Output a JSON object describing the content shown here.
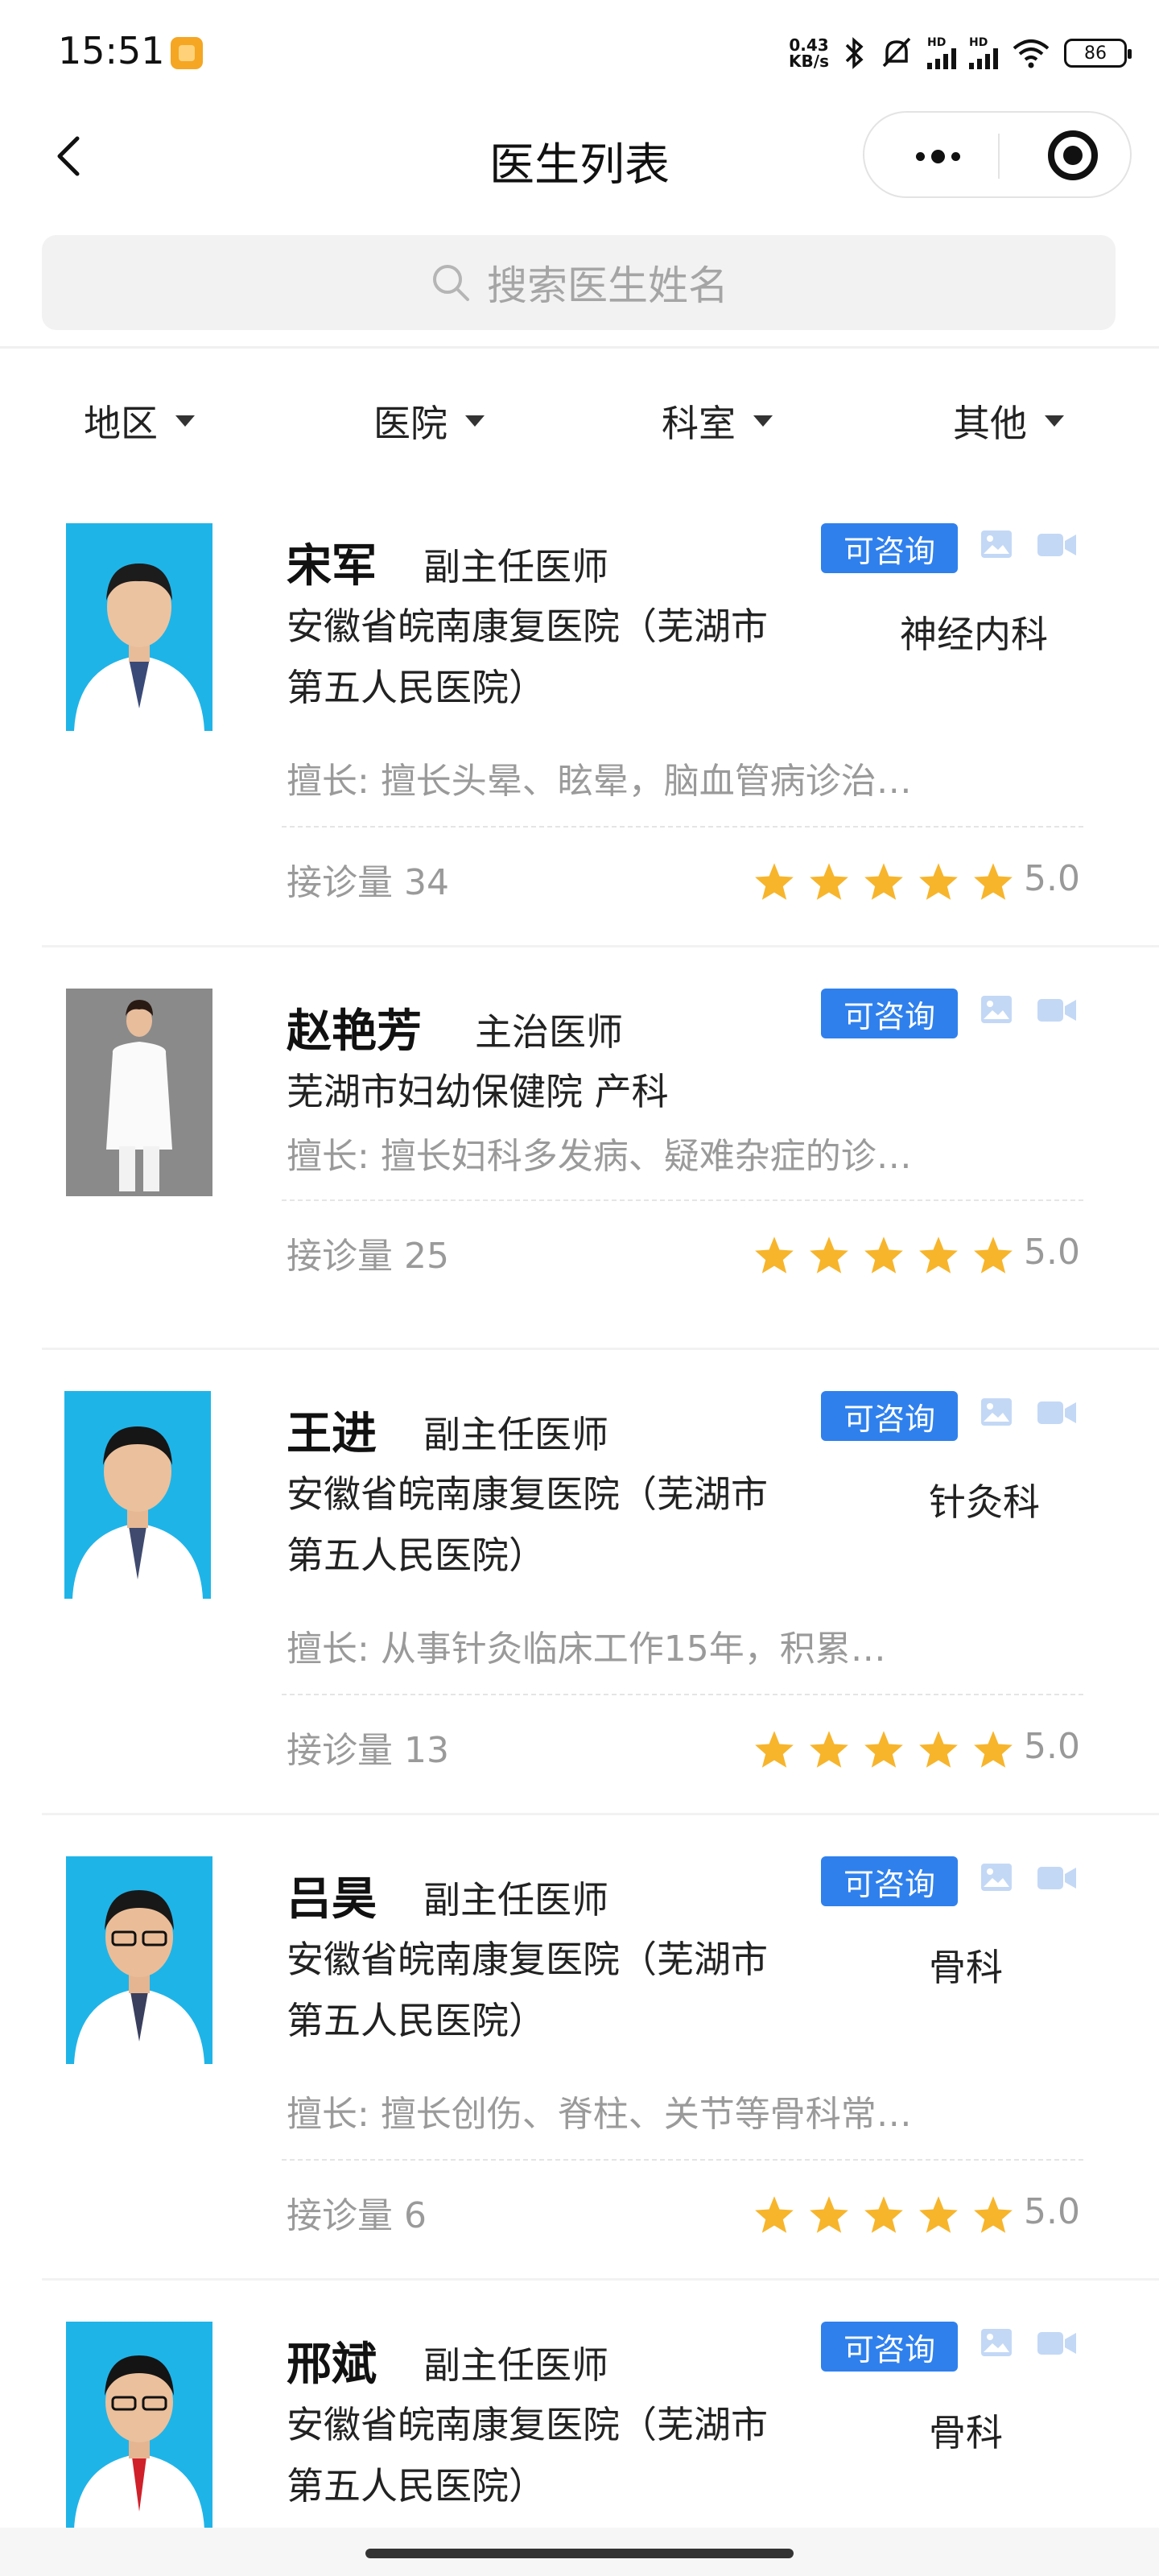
{
  "status_bar": {
    "time": "15:51",
    "speed_value": "0.43",
    "speed_unit": "KB/s",
    "signal_tag_1": "HD",
    "signal_tag_2": "HD",
    "battery": "86"
  },
  "nav": {
    "title": "医生列表"
  },
  "search": {
    "placeholder": "搜索医生姓名"
  },
  "filters": [
    "地区",
    "医院",
    "科室",
    "其他"
  ],
  "labels": {
    "consult_badge": "可咨询",
    "skill_prefix": "擅长: ",
    "visits_prefix": "接诊量 "
  },
  "colors": {
    "accent": "#2f80ed",
    "star": "#f7b52c",
    "photo_bg_blue": "#1fb4e8",
    "photo_bg_gray": "#8c8c8c"
  },
  "doctors": [
    {
      "name": "宋军",
      "title": "副主任医师",
      "hospital_line1": "安徽省皖南康复医院（芜湖市",
      "hospital_line2": "第五人民医院）",
      "department": "神经内科",
      "skill": "擅长头晕、眩晕，脑血管病诊治…",
      "visits": "34",
      "rating": "5.0"
    },
    {
      "name": "赵艳芳",
      "title": "主治医师",
      "hospital_line1": "芜湖市妇幼保健院 产科",
      "hospital_line2": "",
      "department": "",
      "skill": "擅长妇科多发病、疑难杂症的诊…",
      "visits": "25",
      "rating": "5.0"
    },
    {
      "name": "王进",
      "title": "副主任医师",
      "hospital_line1": "安徽省皖南康复医院（芜湖市",
      "hospital_line2": "第五人民医院）",
      "department": "针灸科",
      "skill": "从事针灸临床工作15年，积累…",
      "visits": "13",
      "rating": "5.0"
    },
    {
      "name": "吕昊",
      "title": "副主任医师",
      "hospital_line1": "安徽省皖南康复医院（芜湖市",
      "hospital_line2": "第五人民医院）",
      "department": "骨科",
      "skill": "擅长创伤、脊柱、关节等骨科常…",
      "visits": "6",
      "rating": "5.0"
    },
    {
      "name": "邢斌",
      "title": "副主任医师",
      "hospital_line1": "安徽省皖南康复医院（芜湖市",
      "hospital_line2": "第五人民医院）",
      "department": "骨科",
      "skill": "",
      "visits": "",
      "rating": ""
    }
  ]
}
